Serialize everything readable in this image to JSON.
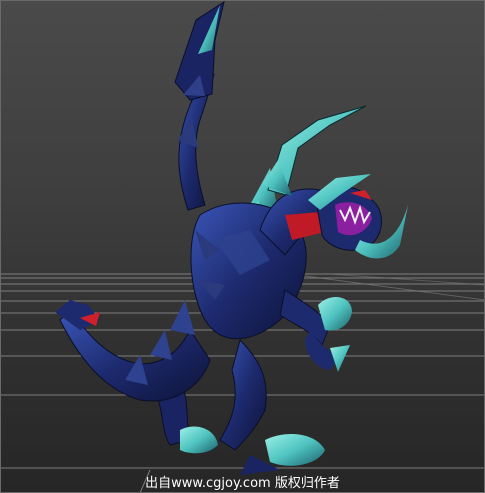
{
  "viewport": {
    "grid_visible": true,
    "colors": {
      "background_top": "#4a4a4a",
      "background_bottom": "#262626",
      "grid_line": "#8c8c8c",
      "creature_body": "#1d2a6e",
      "creature_highlight": "#3b56b8",
      "horn_teal": "#4fc4c0",
      "mouth_purple": "#8a1fa0",
      "accent_red": "#d0202a"
    }
  },
  "model": {
    "icon": "dragon-creature-3d-model"
  },
  "watermark": {
    "text": "出自www.cgjoy.com 版权归作者"
  }
}
